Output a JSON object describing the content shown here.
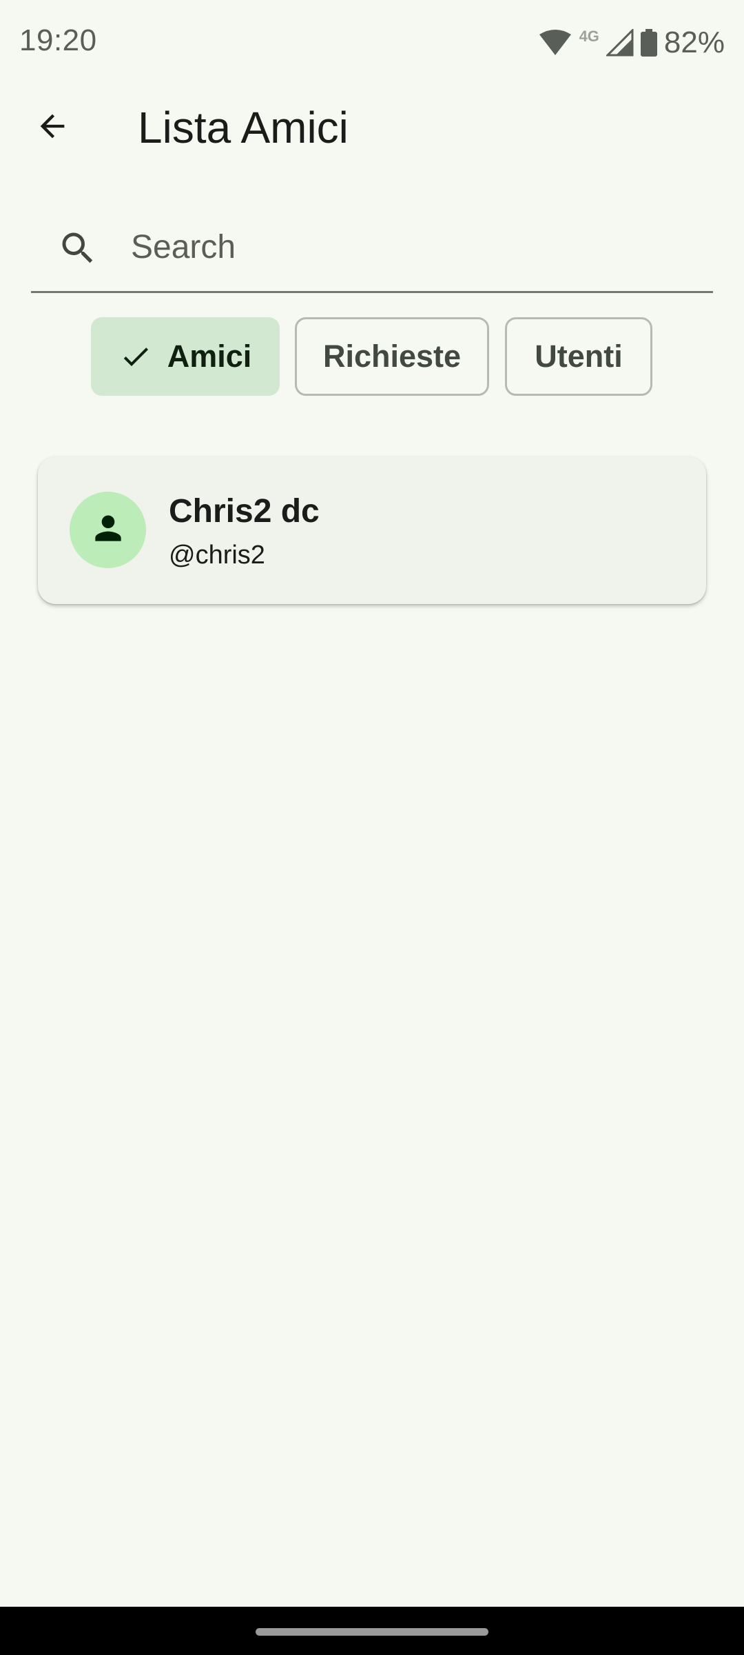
{
  "status_bar": {
    "time": "19:20",
    "network_label": "4G",
    "battery": "82%"
  },
  "app_bar": {
    "title": "Lista Amici",
    "back_icon": "arrow-back-icon"
  },
  "search": {
    "placeholder": "Search",
    "value": "",
    "icon": "search-icon"
  },
  "filters": {
    "selected": "Amici",
    "chips": [
      {
        "label": "Amici",
        "selected": true
      },
      {
        "label": "Richieste",
        "selected": false
      },
      {
        "label": "Utenti",
        "selected": false
      }
    ]
  },
  "friends": [
    {
      "name": "Chris2 dc",
      "username": "@chris2",
      "avatar_icon": "person-icon"
    }
  ],
  "colors": {
    "background": "#f6f9f1",
    "chip_selected": "#d3e8d1",
    "avatar": "#bcecb8",
    "card": "#f0f3ec"
  }
}
